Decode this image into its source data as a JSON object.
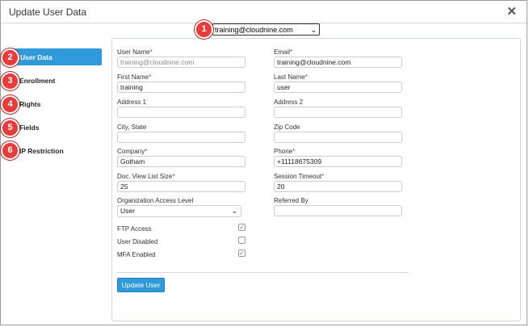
{
  "dialog": {
    "title": "Update User Data",
    "close_symbol": "✕"
  },
  "user_select": {
    "value": "training@cloudnine.com",
    "chevron": "⌄"
  },
  "markers": [
    "1",
    "2",
    "3",
    "4",
    "5",
    "6"
  ],
  "nav": {
    "items": [
      {
        "label": "User Data",
        "active": true
      },
      {
        "label": "Enrollment"
      },
      {
        "label": "Rights"
      },
      {
        "label": "Fields"
      },
      {
        "label": "IP Restriction"
      }
    ]
  },
  "form": {
    "required_mark": "*",
    "user_name": {
      "label": "User Name",
      "value": "training@cloudnine.com"
    },
    "email": {
      "label": "Email",
      "value": "training@cloudnine.com"
    },
    "first_name": {
      "label": "First Name",
      "value": "training"
    },
    "last_name": {
      "label": "Last Name",
      "value": "user"
    },
    "address1": {
      "label": "Address 1",
      "value": ""
    },
    "address2": {
      "label": "Address 2",
      "value": ""
    },
    "city_state": {
      "label": "City, State",
      "value": ""
    },
    "zip": {
      "label": "Zip Code",
      "value": ""
    },
    "company": {
      "label": "Company",
      "value": "Gotham"
    },
    "phone": {
      "label": "Phone",
      "value": "+11118675309"
    },
    "doc_view": {
      "label": "Doc. View List Size",
      "value": "25"
    },
    "session_timeout": {
      "label": "Session Timeout",
      "value": "20"
    },
    "org_access": {
      "label": "Organization Access Level",
      "value": "User"
    },
    "referred_by": {
      "label": "Referred By",
      "value": ""
    },
    "ftp": {
      "label": "FTP Access",
      "checked": true
    },
    "disabled": {
      "label": "User Disabled",
      "checked": false
    },
    "mfa": {
      "label": "MFA Enabled",
      "checked": true
    },
    "check_mark": "✓",
    "submit_label": "Update User"
  }
}
